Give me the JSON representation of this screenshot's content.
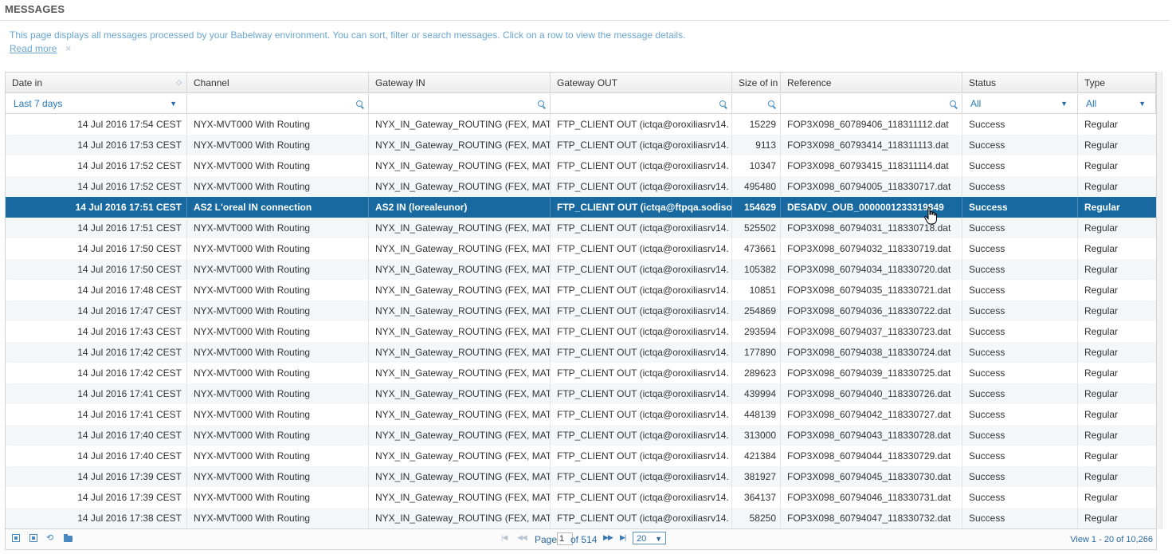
{
  "page": {
    "title": "MESSAGES",
    "intro": "This page displays all messages processed by your Babelway environment. You can sort, filter or search messages. Click on a row to view the message details.",
    "read_more": "Read more",
    "dismiss_glyph": "×"
  },
  "grid": {
    "columns": [
      "Date in",
      "Channel",
      "Gateway IN",
      "Gateway OUT",
      "Size of in",
      "Reference",
      "Status",
      "Type"
    ],
    "filters": {
      "date": "Last 7 days",
      "status": "All",
      "type": "All"
    },
    "selected_row_index": 4,
    "rows": [
      [
        "14 Jul 2016 17:54 CEST",
        "NYX-MVT000 With Routing",
        "NYX_IN_Gateway_ROUTING (FEX, MAT",
        "FTP_CLIENT OUT (ictqa@oroxiliasrv14.",
        "15229",
        "FOP3X098_60789406_118311112.dat",
        "Success",
        "Regular"
      ],
      [
        "14 Jul 2016 17:53 CEST",
        "NYX-MVT000 With Routing",
        "NYX_IN_Gateway_ROUTING (FEX, MAT",
        "FTP_CLIENT OUT (ictqa@oroxiliasrv14.",
        "9113",
        "FOP3X098_60793414_118311113.dat",
        "Success",
        "Regular"
      ],
      [
        "14 Jul 2016 17:52 CEST",
        "NYX-MVT000 With Routing",
        "NYX_IN_Gateway_ROUTING (FEX, MAT",
        "FTP_CLIENT OUT (ictqa@oroxiliasrv14.",
        "10347",
        "FOP3X098_60793415_118311114.dat",
        "Success",
        "Regular"
      ],
      [
        "14 Jul 2016 17:52 CEST",
        "NYX-MVT000 With Routing",
        "NYX_IN_Gateway_ROUTING (FEX, MAT",
        "FTP_CLIENT OUT (ictqa@oroxiliasrv14.",
        "495480",
        "FOP3X098_60794005_118330717.dat",
        "Success",
        "Regular"
      ],
      [
        "14 Jul 2016 17:51 CEST",
        "AS2 L'oreal IN connection",
        "AS2 IN (lorealeunor)",
        "FTP_CLIENT OUT (ictqa@ftpqa.sodisoft",
        "154629",
        "DESADV_OUB_0000001233319849",
        "Success",
        "Regular"
      ],
      [
        "14 Jul 2016 17:51 CEST",
        "NYX-MVT000 With Routing",
        "NYX_IN_Gateway_ROUTING (FEX, MAT",
        "FTP_CLIENT OUT (ictqa@oroxiliasrv14.",
        "525502",
        "FOP3X098_60794031_118330718.dat",
        "Success",
        "Regular"
      ],
      [
        "14 Jul 2016 17:50 CEST",
        "NYX-MVT000 With Routing",
        "NYX_IN_Gateway_ROUTING (FEX, MAT",
        "FTP_CLIENT OUT (ictqa@oroxiliasrv14.",
        "473661",
        "FOP3X098_60794032_118330719.dat",
        "Success",
        "Regular"
      ],
      [
        "14 Jul 2016 17:50 CEST",
        "NYX-MVT000 With Routing",
        "NYX_IN_Gateway_ROUTING (FEX, MAT",
        "FTP_CLIENT OUT (ictqa@oroxiliasrv14.",
        "105382",
        "FOP3X098_60794034_118330720.dat",
        "Success",
        "Regular"
      ],
      [
        "14 Jul 2016 17:48 CEST",
        "NYX-MVT000 With Routing",
        "NYX_IN_Gateway_ROUTING (FEX, MAT",
        "FTP_CLIENT OUT (ictqa@oroxiliasrv14.",
        "10851",
        "FOP3X098_60794035_118330721.dat",
        "Success",
        "Regular"
      ],
      [
        "14 Jul 2016 17:47 CEST",
        "NYX-MVT000 With Routing",
        "NYX_IN_Gateway_ROUTING (FEX, MAT",
        "FTP_CLIENT OUT (ictqa@oroxiliasrv14.",
        "254869",
        "FOP3X098_60794036_118330722.dat",
        "Success",
        "Regular"
      ],
      [
        "14 Jul 2016 17:43 CEST",
        "NYX-MVT000 With Routing",
        "NYX_IN_Gateway_ROUTING (FEX, MAT",
        "FTP_CLIENT OUT (ictqa@oroxiliasrv14.",
        "293594",
        "FOP3X098_60794037_118330723.dat",
        "Success",
        "Regular"
      ],
      [
        "14 Jul 2016 17:42 CEST",
        "NYX-MVT000 With Routing",
        "NYX_IN_Gateway_ROUTING (FEX, MAT",
        "FTP_CLIENT OUT (ictqa@oroxiliasrv14.",
        "177890",
        "FOP3X098_60794038_118330724.dat",
        "Success",
        "Regular"
      ],
      [
        "14 Jul 2016 17:42 CEST",
        "NYX-MVT000 With Routing",
        "NYX_IN_Gateway_ROUTING (FEX, MAT",
        "FTP_CLIENT OUT (ictqa@oroxiliasrv14.",
        "289623",
        "FOP3X098_60794039_118330725.dat",
        "Success",
        "Regular"
      ],
      [
        "14 Jul 2016 17:41 CEST",
        "NYX-MVT000 With Routing",
        "NYX_IN_Gateway_ROUTING (FEX, MAT",
        "FTP_CLIENT OUT (ictqa@oroxiliasrv14.",
        "439994",
        "FOP3X098_60794040_118330726.dat",
        "Success",
        "Regular"
      ],
      [
        "14 Jul 2016 17:41 CEST",
        "NYX-MVT000 With Routing",
        "NYX_IN_Gateway_ROUTING (FEX, MAT",
        "FTP_CLIENT OUT (ictqa@oroxiliasrv14.",
        "448139",
        "FOP3X098_60794042_118330727.dat",
        "Success",
        "Regular"
      ],
      [
        "14 Jul 2016 17:40 CEST",
        "NYX-MVT000 With Routing",
        "NYX_IN_Gateway_ROUTING (FEX, MAT",
        "FTP_CLIENT OUT (ictqa@oroxiliasrv14.",
        "313000",
        "FOP3X098_60794043_118330728.dat",
        "Success",
        "Regular"
      ],
      [
        "14 Jul 2016 17:40 CEST",
        "NYX-MVT000 With Routing",
        "NYX_IN_Gateway_ROUTING (FEX, MAT",
        "FTP_CLIENT OUT (ictqa@oroxiliasrv14.",
        "421384",
        "FOP3X098_60794044_118330729.dat",
        "Success",
        "Regular"
      ],
      [
        "14 Jul 2016 17:39 CEST",
        "NYX-MVT000 With Routing",
        "NYX_IN_Gateway_ROUTING (FEX, MAT",
        "FTP_CLIENT OUT (ictqa@oroxiliasrv14.",
        "381927",
        "FOP3X098_60794045_118330730.dat",
        "Success",
        "Regular"
      ],
      [
        "14 Jul 2016 17:39 CEST",
        "NYX-MVT000 With Routing",
        "NYX_IN_Gateway_ROUTING (FEX, MAT",
        "FTP_CLIENT OUT (ictqa@oroxiliasrv14.",
        "364137",
        "FOP3X098_60794046_118330731.dat",
        "Success",
        "Regular"
      ],
      [
        "14 Jul 2016 17:38 CEST",
        "NYX-MVT000 With Routing",
        "NYX_IN_Gateway_ROUTING (FEX, MAT",
        "FTP_CLIENT OUT (ictqa@oroxiliasrv14.",
        "58250",
        "FOP3X098_60794047_118330732.dat",
        "Success",
        "Regular"
      ]
    ]
  },
  "pager": {
    "page_label": "Page",
    "page_value": "1",
    "of_label": "of 514",
    "page_size": "20",
    "view_info": "View 1 - 20 of 10,266"
  },
  "icons": {
    "sort": "sort-icon",
    "search": "search-icon",
    "dropdown": "chevron-down-icon",
    "first": "first-page-icon",
    "prev": "prev-page-icon",
    "next": "next-page-icon",
    "last": "last-page-icon",
    "refresh": "refresh-icon",
    "folder": "folder-icon"
  },
  "colors": {
    "accent": "#1769a0",
    "link": "#6aa6cf",
    "row_alt": "#f4f7fa"
  }
}
